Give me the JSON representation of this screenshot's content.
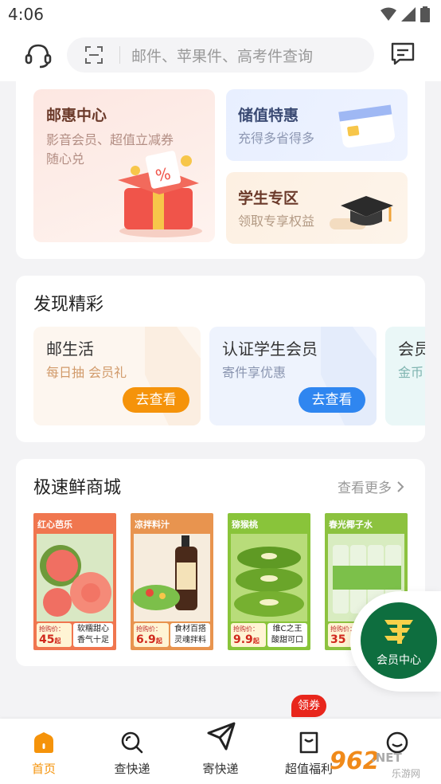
{
  "status_bar": {
    "time": "4:06"
  },
  "search": {
    "placeholder": "邮件、苹果件、高考件查询"
  },
  "promos": {
    "center": {
      "title": "邮惠中心",
      "line1": "影音会员、超值立减券",
      "line2": "随心兑"
    },
    "value": {
      "title": "储值特惠",
      "subtitle": "充得多省得多"
    },
    "student": {
      "title": "学生专区",
      "subtitle": "领取专享权益"
    }
  },
  "discover": {
    "title": "发现精彩",
    "items": [
      {
        "title": "邮生活",
        "subtitle": "每日抽 会员礼",
        "button": "去查看"
      },
      {
        "title": "认证学生会员",
        "subtitle": "寄件享优惠",
        "button": "去查看"
      },
      {
        "title": "会员",
        "subtitle": "金币"
      }
    ]
  },
  "mall": {
    "title": "极速鲜商城",
    "more": "查看更多",
    "products": [
      {
        "tag": "红心芭乐",
        "price_label": "抢购价：",
        "price": "45",
        "unit": "起",
        "desc": "软糯甜心 香气十足"
      },
      {
        "tag": "凉拌料汁",
        "price_label": "抢购价：",
        "price": "6.9",
        "unit": "起",
        "desc": "食材百搭 灵魂拌料"
      },
      {
        "tag": "猕猴桃",
        "price_label": "抢购价：",
        "price": "9.9",
        "unit": "起",
        "desc": "维C之王 酸甜可口"
      },
      {
        "tag": "春光椰子水",
        "price_label": "抢购价：",
        "price": "35",
        "unit": ""
      }
    ]
  },
  "fab": {
    "label": "会员中心"
  },
  "tabs": {
    "home": "首页",
    "query": "查快递",
    "send": "寄快递",
    "welfare": "超值福利",
    "badge": "领券"
  },
  "watermark": {
    "num": "962",
    "net": ".NET",
    "site": "乐游网"
  },
  "colors": {
    "accent": "#f5930a",
    "blue": "#2f86f0",
    "brand_green": "#0e6e3f",
    "badge_red": "#e8261c"
  }
}
